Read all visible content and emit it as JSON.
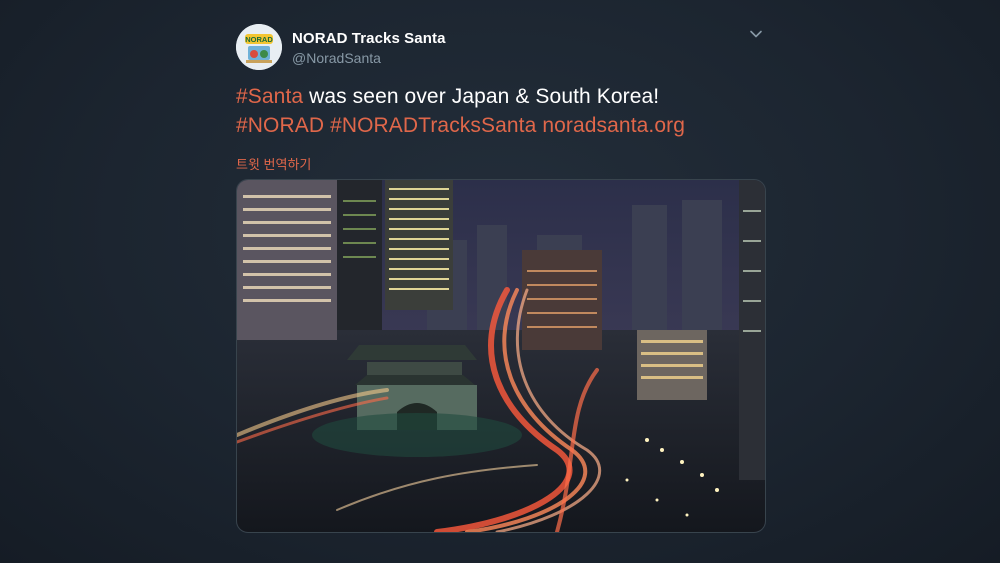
{
  "tweet": {
    "author": {
      "display_name": "NORAD Tracks Santa",
      "handle": "@NoradSanta",
      "avatar_text": "NORAD"
    },
    "menu_icon": "chevron-down-icon",
    "text": {
      "hashtag_santa": "#Santa",
      "line1_rest": " was seen over Japan & South Korea!",
      "hashtag_norad": "#NORAD",
      "hashtag_tracks": "#NORADTracksSanta",
      "link": "noradsanta.org"
    },
    "translate_label": "트윗 번역하기",
    "media_icon": "city-night-photo"
  },
  "colors": {
    "background": "#1c2530",
    "link": "#e0674a",
    "text": "#ffffff",
    "secondary": "#8899a6"
  }
}
